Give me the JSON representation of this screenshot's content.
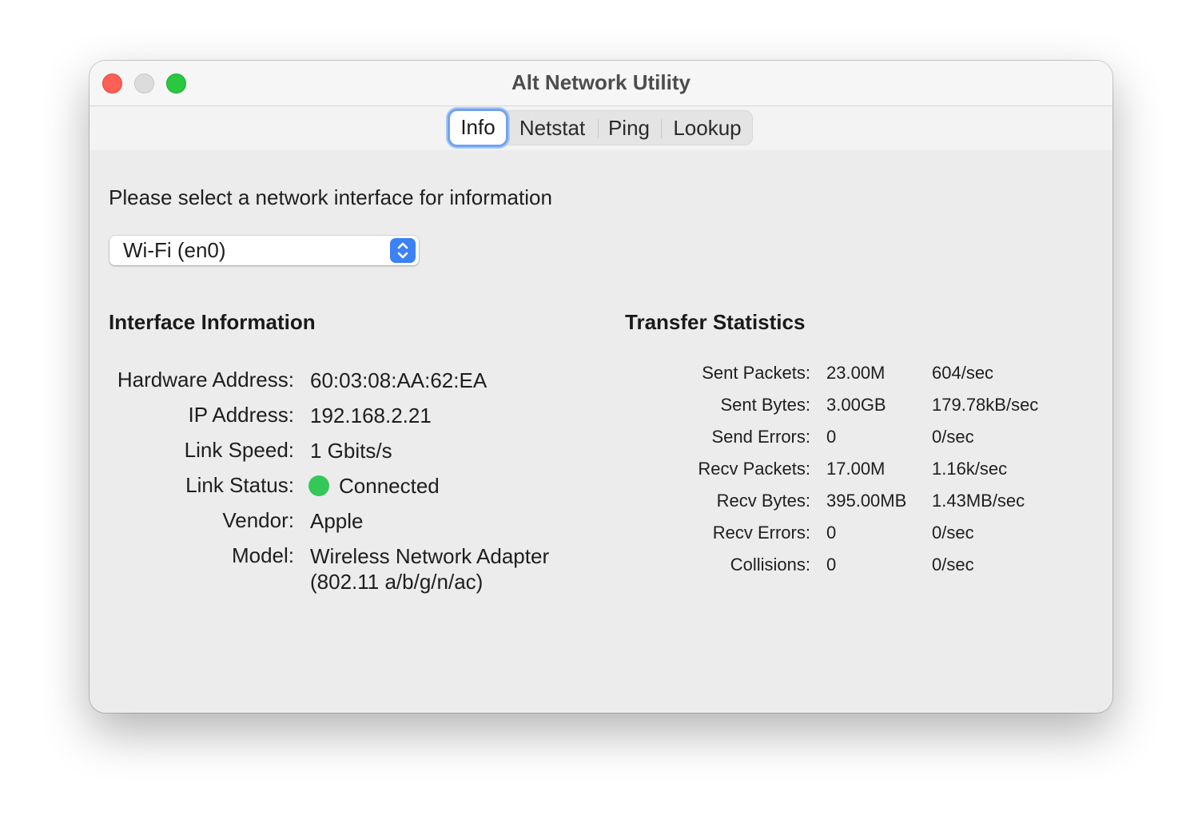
{
  "window": {
    "title": "Alt Network Utility"
  },
  "tabs": [
    {
      "label": "Info",
      "selected": true
    },
    {
      "label": "Netstat",
      "selected": false
    },
    {
      "label": "Ping",
      "selected": false
    },
    {
      "label": "Lookup",
      "selected": false
    }
  ],
  "info": {
    "prompt": "Please select a network interface for information",
    "interface_select": {
      "value": "Wi-Fi (en0)"
    },
    "interface_information": {
      "heading": "Interface Information",
      "rows": [
        {
          "label": "Hardware Address:",
          "value": "60:03:08:AA:62:EA"
        },
        {
          "label": "IP Address:",
          "value": "192.168.2.21"
        },
        {
          "label": "Link Speed:",
          "value": "1 Gbits/s"
        },
        {
          "label": "Link Status:",
          "value": "Connected",
          "status_color": "#34c759"
        },
        {
          "label": "Vendor:",
          "value": "Apple"
        },
        {
          "label": "Model:",
          "value": "Wireless Network Adapter",
          "value_line2": "(802.11 a/b/g/n/ac)"
        }
      ]
    },
    "transfer_statistics": {
      "heading": "Transfer Statistics",
      "rows": [
        {
          "label": "Sent Packets:",
          "total": "23.00M",
          "rate": "604/sec"
        },
        {
          "label": "Sent Bytes:",
          "total": "3.00GB",
          "rate": "179.78kB/sec"
        },
        {
          "label": "Send Errors:",
          "total": "0",
          "rate": "0/sec"
        },
        {
          "label": "Recv Packets:",
          "total": "17.00M",
          "rate": "1.16k/sec"
        },
        {
          "label": "Recv Bytes:",
          "total": "395.00MB",
          "rate": "1.43MB/sec"
        },
        {
          "label": "Recv Errors:",
          "total": "0",
          "rate": "0/sec"
        },
        {
          "label": "Collisions:",
          "total": "0",
          "rate": "0/sec"
        }
      ]
    }
  },
  "colors": {
    "accent": "#3b82f6",
    "close": "#fe5f57",
    "zoom": "#28c840",
    "connected": "#34c759"
  },
  "icons": {
    "popup": "chevron-up-down-icon"
  }
}
